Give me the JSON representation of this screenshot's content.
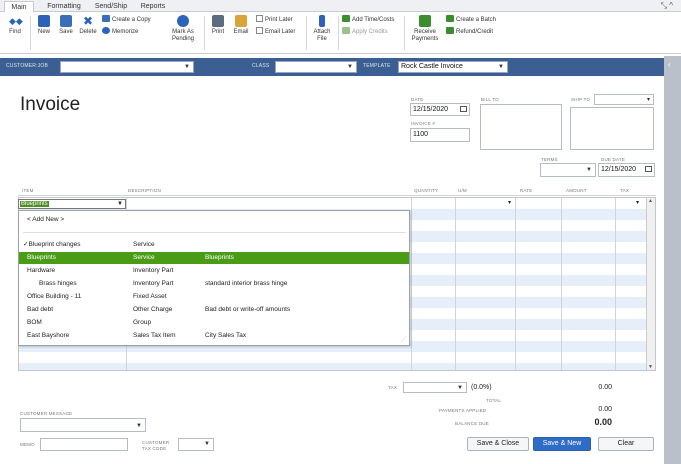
{
  "tabs": [
    "Main",
    "Formatting",
    "Send/Ship",
    "Reports"
  ],
  "window_controls": "⤡ ^",
  "ribbon": {
    "find": "Find",
    "new": "New",
    "save": "Save",
    "delete": "Delete",
    "create_copy": "Create a Copy",
    "memorize": "Memorize",
    "mark_pending": "Mark As Pending",
    "print": "Print",
    "email": "Email",
    "print_later": "Print Later",
    "email_later": "Email Later",
    "attach_file": "Attach File",
    "add_time_costs": "Add Time/Costs",
    "apply_credits": "Apply Credits",
    "receive_payments": "Receive Payments",
    "create_batch": "Create a Batch",
    "refund_credit": "Refund/Credit"
  },
  "custbar": {
    "customer_job_label": "CUSTOMER:JOB",
    "class_label": "CLASS",
    "template_label": "TEMPLATE",
    "template_value": "Rock Castle Invoice"
  },
  "form": {
    "title": "Invoice",
    "date_label": "DATE",
    "date_value": "12/15/2020",
    "invoice_no_label": "INVOICE #",
    "invoice_no_value": "1100",
    "bill_to_label": "BILL TO",
    "ship_to_label": "SHIP TO",
    "terms_label": "TERMS",
    "due_date_label": "DUE DATE",
    "due_date_value": "12/15/2020"
  },
  "grid": {
    "headers": {
      "item": "ITEM",
      "description": "DESCRIPTION",
      "quantity": "QUANTITY",
      "um": "U/M",
      "rate": "RATE",
      "amount": "AMOUNT",
      "tax": "TAX"
    },
    "item_value": "Blueprints"
  },
  "dropdown": {
    "add_new": "< Add New >",
    "items": [
      {
        "name": "✓Blueprint changes",
        "type": "Service",
        "desc": ""
      },
      {
        "name": "Blueprints",
        "type": "Service",
        "desc": "Blueprints"
      },
      {
        "name": "Hardware",
        "type": "Inventory Part",
        "desc": ""
      },
      {
        "name": "Brass hinges",
        "type": "Inventory Part",
        "desc": "standard interior brass hinge"
      },
      {
        "name": "Office Building - 11",
        "type": "Fixed Asset",
        "desc": ""
      },
      {
        "name": "Bad debt",
        "type": "Other Charge",
        "desc": "Bad debt or write-off amounts"
      },
      {
        "name": "BOM",
        "type": "Group",
        "desc": ""
      },
      {
        "name": "East Bayshore",
        "type": "Sales Tax Item",
        "desc": "City Sales Tax"
      }
    ]
  },
  "totals": {
    "tax_label": "TAX",
    "tax_pct": "(0.0%)",
    "tax_value": "0.00",
    "total_label": "TOTAL",
    "payments_applied_label": "PAYMENTS APPLIED",
    "payments_applied_value": "0.00",
    "balance_due_label": "BALANCE DUE",
    "balance_due_value": "0.00"
  },
  "footer": {
    "customer_message_label": "CUSTOMER MESSAGE",
    "memo_label": "MEMO",
    "customer_tax_code_label": "CUSTOMER TAX CODE",
    "save_close": "Save & Close",
    "save_new": "Save & New",
    "clear": "Clear"
  },
  "colors": {
    "header_bar": "#3b5f93",
    "selected_row": "#4a9c17",
    "primary_button": "#2e6dc7",
    "grid_alt_row": "#e6eefa"
  }
}
